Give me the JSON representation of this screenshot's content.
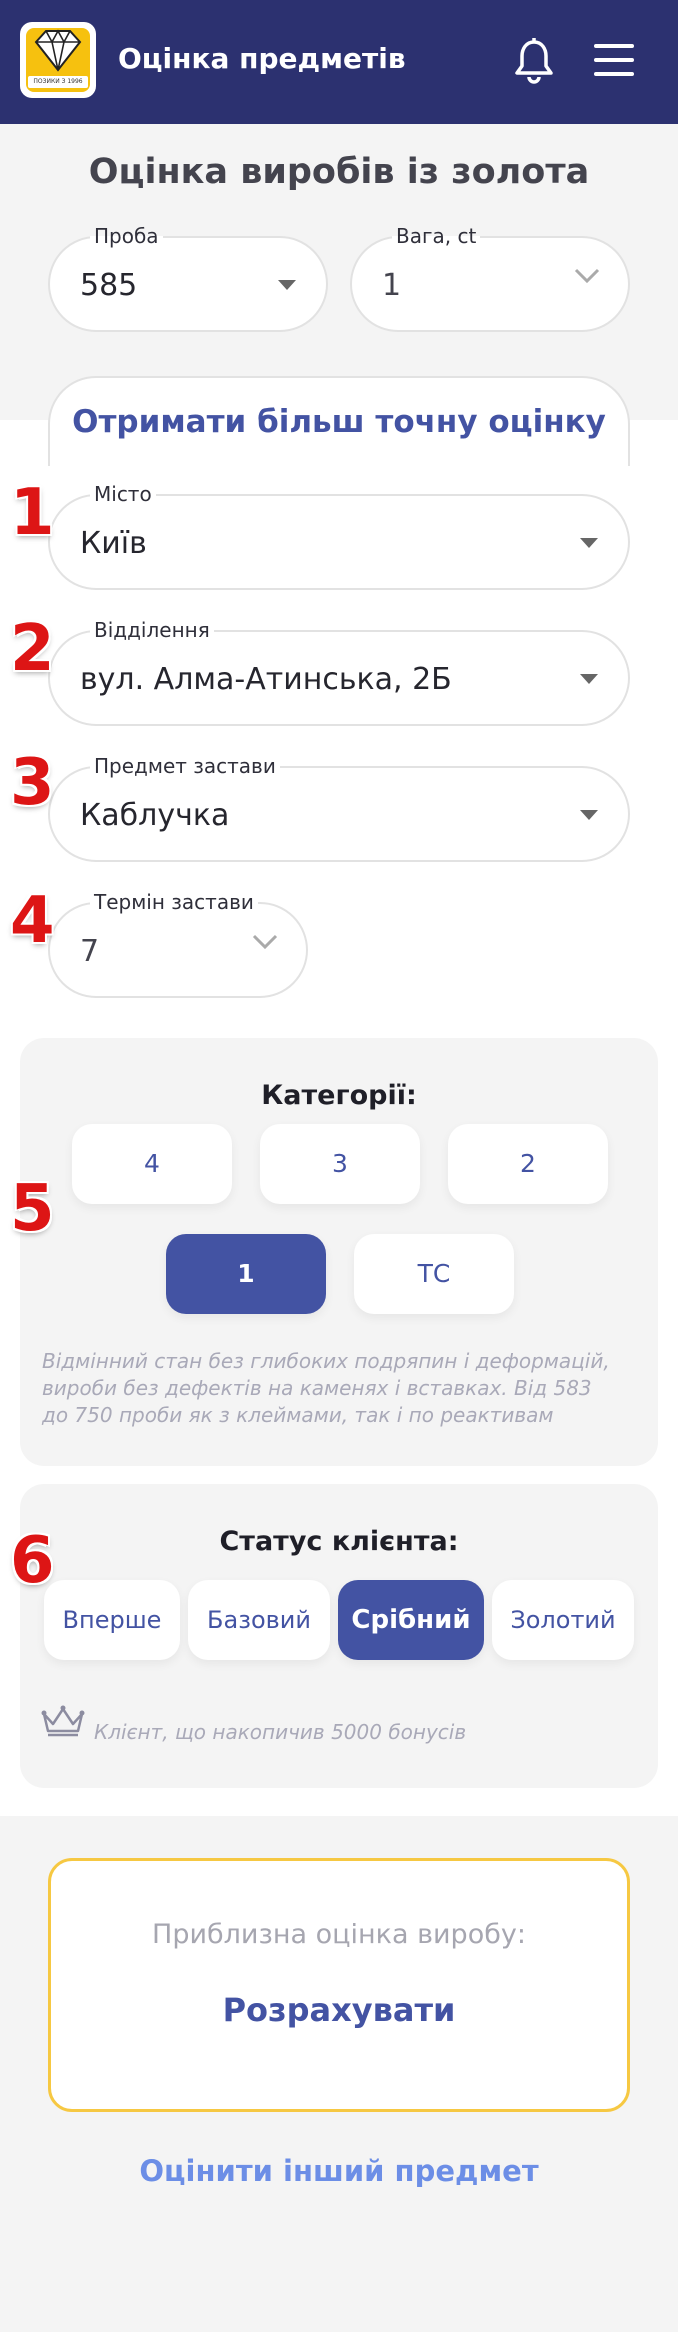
{
  "header": {
    "title": "Оцінка предметів",
    "logo_tag": "ПОЗИКИ З 1996",
    "bell_icon": "bell-icon",
    "menu_icon": "hamburger-menu-icon",
    "background_color": "#2c3170"
  },
  "quick_estimate": {
    "title": "Оцінка виробів із золота",
    "fineness": {
      "label": "Проба",
      "value": "585"
    },
    "weight": {
      "label": "Вага, ct",
      "value": "1"
    }
  },
  "accurate_tab": {
    "label": "Отримати більш точну оцінку"
  },
  "form": {
    "markers": [
      "1",
      "2",
      "3",
      "4",
      "5",
      "6"
    ],
    "city": {
      "label": "Місто",
      "value": "Київ"
    },
    "branch": {
      "label": "Відділення",
      "value": "вул. Алма-Атинська, 2Б"
    },
    "item": {
      "label": "Предмет застави",
      "value": "Каблучка"
    },
    "term": {
      "label": "Термін застави",
      "value": "7"
    }
  },
  "categories": {
    "title": "Категорії:",
    "options": [
      "4",
      "3",
      "2",
      "1",
      "ТС"
    ],
    "selected": "1",
    "description": "Відмінний стан без глибоких подряпин і деформацій, вироби без дефектів на каменях і вставках. Від 583 до 750 проби як з клеймами, так і по реактивам"
  },
  "client_status": {
    "title": "Статус клієнта:",
    "options": [
      "Вперше",
      "Базовий",
      "Срібний",
      "Золотий"
    ],
    "selected": "Срібний",
    "note": "Клієнт, що накопичив 5000 бонусів",
    "note_icon": "crown-icon"
  },
  "result": {
    "label": "Приблизна оцінка виробу:",
    "calculate_label": "Розрахувати",
    "border_color": "#f6c842"
  },
  "footer_link": {
    "label": "Оцінити інший предмет"
  },
  "colors": {
    "accent": "#4353a3",
    "marker": "#dd1515",
    "link": "#6c8ee6"
  }
}
